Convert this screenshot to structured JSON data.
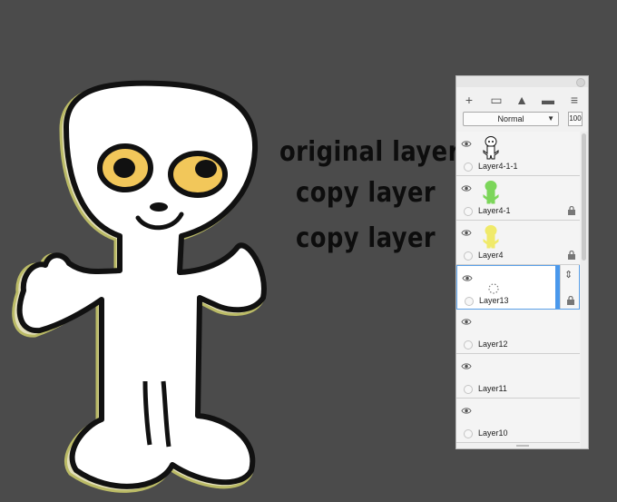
{
  "annotations": {
    "line1": "original layer",
    "line2": "copy layer",
    "line3": "copy layer"
  },
  "panel": {
    "blend_mode": "Normal",
    "opacity": "100",
    "toolbar": [
      {
        "name": "add-layer-icon",
        "glyph": "+"
      },
      {
        "name": "new-folder-icon",
        "glyph": "▭"
      },
      {
        "name": "image-layer-icon",
        "glyph": "▲"
      },
      {
        "name": "delete-layer-icon",
        "glyph": "▬"
      },
      {
        "name": "menu-icon",
        "glyph": "≡"
      }
    ],
    "layers": [
      {
        "name": "Layer4-1-1",
        "thumb": "black",
        "locked": false,
        "selected": false
      },
      {
        "name": "Layer4-1",
        "thumb": "green",
        "locked": true,
        "selected": false
      },
      {
        "name": "Layer4",
        "thumb": "yellow",
        "locked": true,
        "selected": false
      },
      {
        "name": "Layer13",
        "thumb": "loading",
        "locked": true,
        "selected": true
      },
      {
        "name": "Layer12",
        "thumb": "none",
        "locked": false,
        "selected": false
      },
      {
        "name": "Layer11",
        "thumb": "none",
        "locked": false,
        "selected": false
      },
      {
        "name": "Layer10",
        "thumb": "none",
        "locked": false,
        "selected": false
      }
    ]
  },
  "colors": {
    "canvas_bg": "#4b4b4b",
    "figure_fill": "#ffffff",
    "outline": "#111111",
    "eye_fill": "#f2c75a",
    "selection": "#4a98ec"
  }
}
